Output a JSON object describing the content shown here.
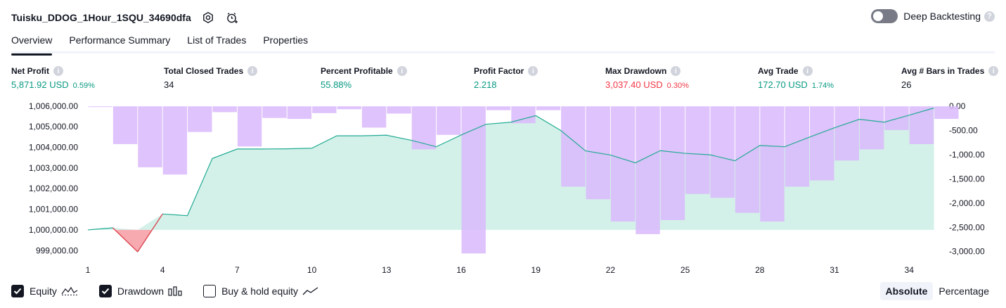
{
  "header": {
    "strategy_name": "Tuisku_DDOG_1Hour_1SQU_34690dfa",
    "deep_backtesting_label": "Deep Backtesting",
    "deep_backtesting_on": false
  },
  "tabs": [
    {
      "label": "Overview",
      "active": true
    },
    {
      "label": "Performance Summary",
      "active": false
    },
    {
      "label": "List of Trades",
      "active": false
    },
    {
      "label": "Properties",
      "active": false
    }
  ],
  "stats": {
    "net_profit": {
      "label": "Net Profit",
      "value": "5,871.92 USD",
      "pct": "0.59%"
    },
    "total_closed_trades": {
      "label": "Total Closed Trades",
      "value": "34"
    },
    "percent_profitable": {
      "label": "Percent Profitable",
      "value": "55.88%"
    },
    "profit_factor": {
      "label": "Profit Factor",
      "value": "2.218"
    },
    "max_drawdown": {
      "label": "Max Drawdown",
      "value": "3,037.40 USD",
      "pct": "0.30%"
    },
    "avg_trade": {
      "label": "Avg Trade",
      "value": "172.70 USD",
      "pct": "1.74%"
    },
    "avg_bars": {
      "label": "Avg # Bars in Trades",
      "value": "26"
    }
  },
  "colors": {
    "positive": "#089981",
    "negative": "#f23645",
    "equity_line": "#22ab94",
    "equity_fill": "#cdeee5",
    "drawdown_bar": "#d9b8fb",
    "loss_fill": "#f7a1a8"
  },
  "chart_data": {
    "type": "line",
    "x_ticks": [
      1,
      4,
      7,
      10,
      13,
      16,
      19,
      22,
      25,
      28,
      31,
      34
    ],
    "left_axis": {
      "ticks": [
        "1,006,000.00",
        "1,005,000.00",
        "1,004,000.00",
        "1,003,000.00",
        "1,002,000.00",
        "1,001,000.00",
        "1,000,000.00",
        "999,000.00"
      ],
      "ylim": [
        998600,
        1006200
      ]
    },
    "right_axis": {
      "ticks": [
        "0.00",
        "-500.00",
        "-1,000.00",
        "-1,500.00",
        "-2,000.00",
        "-2,500.00",
        "-3,000.00"
      ],
      "ylim": [
        -3150,
        90
      ]
    },
    "series": [
      {
        "name": "Equity",
        "axis": "left",
        "type": "line",
        "baseline": 1000000,
        "values": [
          1000000,
          1000100,
          998940,
          1000770,
          1000690,
          1003460,
          1003920,
          1003920,
          1003930,
          1003960,
          1004560,
          1004560,
          1004590,
          1004340,
          1004030,
          1004600,
          1005120,
          1005220,
          1005540,
          1004820,
          1003830,
          1003630,
          1003250,
          1003840,
          1003710,
          1003640,
          1003350,
          1004090,
          1004030,
          1004500,
          1004950,
          1005360,
          1005220,
          1005560,
          1005910
        ]
      },
      {
        "name": "Drawdown",
        "axis": "right",
        "type": "bar",
        "values": [
          -10,
          -780,
          -1260,
          -1410,
          -530,
          -120,
          -830,
          -240,
          -260,
          -140,
          -60,
          -440,
          -150,
          -890,
          -590,
          -3040,
          -80,
          -350,
          -80,
          -1660,
          -1920,
          -2380,
          -2640,
          -2350,
          -1810,
          -1890,
          -2200,
          -2380,
          -1660,
          -1530,
          -1120,
          -890,
          -490,
          -780,
          -260
        ]
      }
    ]
  },
  "legend": [
    {
      "label": "Equity",
      "checked": true,
      "glyph": "equity-line-icon"
    },
    {
      "label": "Drawdown",
      "checked": true,
      "glyph": "bars-icon"
    },
    {
      "label": "Buy & hold equity",
      "checked": false,
      "glyph": "line-icon"
    }
  ],
  "modes": [
    {
      "label": "Absolute",
      "active": true
    },
    {
      "label": "Percentage",
      "active": false
    }
  ]
}
